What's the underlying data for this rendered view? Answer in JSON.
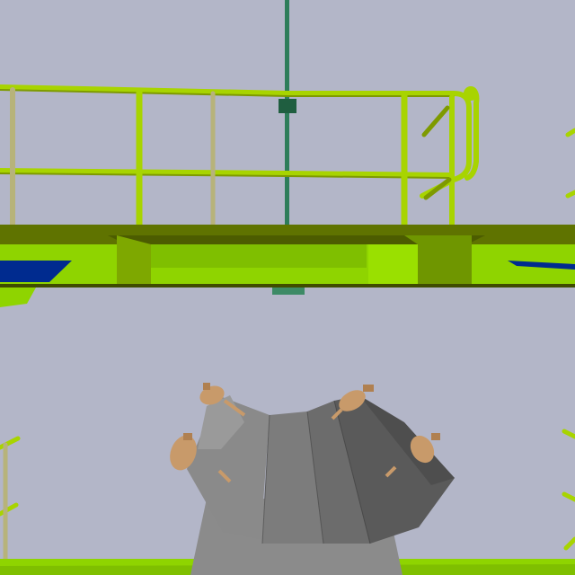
{
  "scene": {
    "type": "3d-viewport",
    "colors": {
      "sky": "#b3b6c8",
      "railing": "#a8d400",
      "railing_shadow": "#7e9a00",
      "railing_far": "#b7b37a",
      "platform_top": "#5f7300",
      "platform_front": "#8fd400",
      "platform_beam": "#6f9600",
      "pole": "#2e7d5a",
      "blue_panel": "#002b8f",
      "machine_light": "#8b8b8b",
      "machine_mid": "#6c6c6c",
      "machine_dark": "#4e4e4e",
      "bolt": "#c89a6a",
      "floor": "#8fd400"
    },
    "objects": [
      "upper-platform",
      "safety-railing",
      "vertical-pole",
      "mechanical-unit",
      "left-railing",
      "right-railing",
      "floor-deck"
    ]
  }
}
